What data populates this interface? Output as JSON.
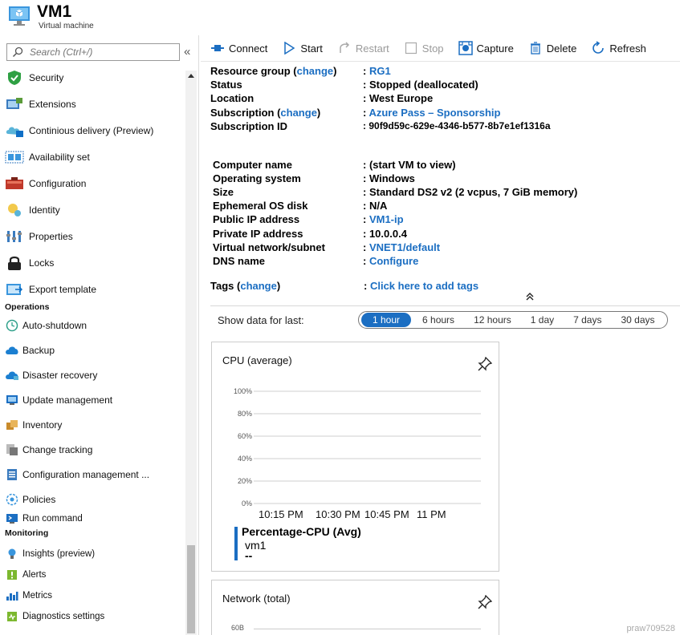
{
  "header": {
    "title": "VM1",
    "subtitle": "Virtual machine"
  },
  "search": {
    "placeholder": "Search (Ctrl+/)"
  },
  "sidebar": {
    "items": [
      {
        "label": "Security",
        "icon": "shield-check-icon"
      },
      {
        "label": "Extensions",
        "icon": "extensions-icon"
      },
      {
        "label": "Continious delivery (Preview)",
        "icon": "continuous-delivery-icon"
      },
      {
        "label": "Availability set",
        "icon": "availability-set-icon"
      },
      {
        "label": "Configuration",
        "icon": "configuration-icon"
      },
      {
        "label": "Identity",
        "icon": "identity-icon"
      },
      {
        "label": "Properties",
        "icon": "properties-icon"
      },
      {
        "label": "Locks",
        "icon": "lock-icon"
      },
      {
        "label": "Export template",
        "icon": "export-template-icon"
      }
    ],
    "operations_label": "Operations",
    "operations": [
      {
        "label": "Auto-shutdown",
        "icon": "clock-icon"
      },
      {
        "label": "Backup",
        "icon": "backup-cloud-icon"
      },
      {
        "label": "Disaster recovery",
        "icon": "disaster-recovery-icon"
      },
      {
        "label": "Update management",
        "icon": "update-management-icon"
      },
      {
        "label": "Inventory",
        "icon": "inventory-icon"
      },
      {
        "label": "Change tracking",
        "icon": "change-tracking-icon"
      },
      {
        "label": "Configuration management ...",
        "icon": "config-management-icon"
      },
      {
        "label": "Policies",
        "icon": "policies-icon"
      },
      {
        "label": "Run command",
        "icon": "run-command-icon"
      }
    ],
    "monitoring_label": "Monitoring",
    "monitoring": [
      {
        "label": "Insights (preview)",
        "icon": "insights-icon"
      },
      {
        "label": "Alerts",
        "icon": "alerts-icon"
      },
      {
        "label": "Metrics",
        "icon": "metrics-icon"
      },
      {
        "label": "Diagnostics settings",
        "icon": "diagnostics-icon"
      }
    ]
  },
  "toolbar": {
    "connect": "Connect",
    "start": "Start",
    "restart": "Restart",
    "stop": "Stop",
    "capture": "Capture",
    "delete": "Delete",
    "refresh": "Refresh"
  },
  "essentials": {
    "resource_group_label": "Resource group",
    "change_label": "change",
    "resource_group": "RG1",
    "status_label": "Status",
    "status": "Stopped (deallocated)",
    "location_label": "Location",
    "location": "West Europe",
    "subscription_label": "Subscription",
    "subscription": "Azure Pass – Sponsorship",
    "subscription_id_label": "Subscription ID",
    "subscription_id": "90f9d59c-629e-4346-b577-8b7e1ef1316a",
    "computer_name_label": "Computer name",
    "computer_name": "(start VM to view)",
    "os_label": "Operating system",
    "os": "Windows",
    "size_label": "Size",
    "size": "Standard DS2 v2 (2 vcpus, 7 GiB memory)",
    "ephemeral_label": "Ephemeral OS disk",
    "ephemeral": "N/A",
    "public_ip_label": "Public IP address",
    "public_ip": "VM1-ip",
    "private_ip_label": "Private IP address",
    "private_ip": "10.0.0.4",
    "vnet_label": "Virtual network/subnet",
    "vnet": "VNET1/default",
    "dns_label": "DNS name",
    "dns": "Configure",
    "tags_label": "Tags",
    "tags": "Click here to add tags"
  },
  "timerange": {
    "label": "Show data for last:",
    "options": [
      "1 hour",
      "6 hours",
      "12 hours",
      "1 day",
      "7 days",
      "30 days"
    ],
    "selected": "1 hour"
  },
  "cpu_tile": {
    "title": "CPU (average)",
    "metric_label": "Percentage-CPU (Avg)",
    "resource": "vm1",
    "value": "--",
    "series_color": "#1b6ec2"
  },
  "network_tile": {
    "title": "Network (total)",
    "first_tick": "60B"
  },
  "watermark": "praw709528",
  "chart_data": {
    "type": "line",
    "title": "CPU (average)",
    "y_ticks": [
      "100%",
      "80%",
      "60%",
      "40%",
      "20%",
      "0%"
    ],
    "ylim": [
      0,
      100
    ],
    "x_ticks": [
      "10:15 PM",
      "10:30 PM",
      "10:45 PM",
      "11 PM"
    ],
    "series": [
      {
        "name": "Percentage-CPU (Avg)",
        "values": []
      }
    ],
    "grid": true
  }
}
